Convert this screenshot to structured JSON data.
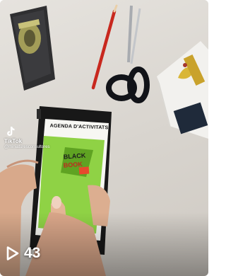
{
  "video": {
    "phone_screen_title": "AGENDA D'ACTIVITATS",
    "poster_text": "BLACK BOOK"
  },
  "watermark": {
    "brand": "TikTok",
    "handle": "@miniaturesconsultores"
  },
  "stats": {
    "play_count": "43",
    "play_icon": "play-outline-icon"
  }
}
